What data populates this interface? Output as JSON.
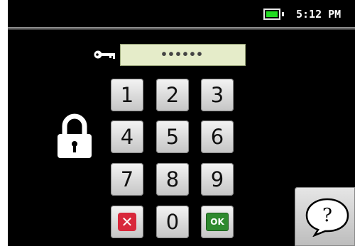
{
  "status": {
    "time": "5:12 PM",
    "battery_color": "#22dd22"
  },
  "pin": {
    "masked_value": "••••••"
  },
  "keypad": {
    "k1": "1",
    "k2": "2",
    "k3": "3",
    "k4": "4",
    "k5": "5",
    "k6": "6",
    "k7": "7",
    "k8": "8",
    "k9": "9",
    "k0": "0",
    "ok": "OK",
    "delete_icon": "delete-icon"
  },
  "help": {
    "symbol": "?"
  }
}
